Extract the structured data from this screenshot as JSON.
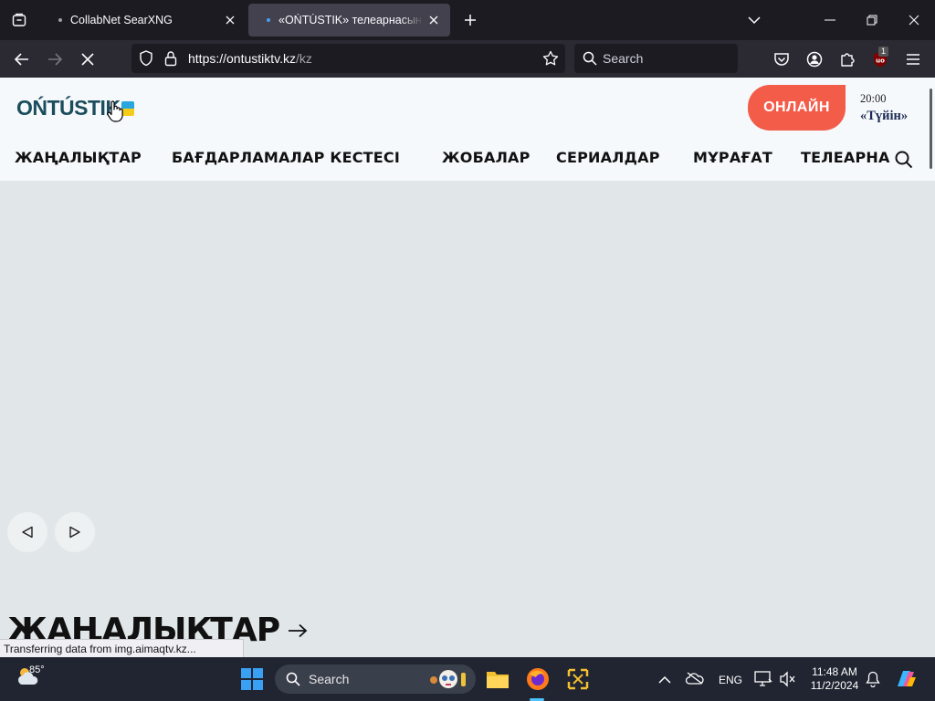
{
  "browser": {
    "tabs": [
      {
        "title": "CollabNet SearXNG",
        "active": false
      },
      {
        "title": "«OŃTÚSTIK» телеарнасының ресми",
        "active": true
      }
    ],
    "url": {
      "host": "https://ontustiktv.kz",
      "path": "/kz"
    },
    "search_placeholder": "Search",
    "extension_badge": "1",
    "status_text": "Transferring data from img.aimaqtv.kz..."
  },
  "site": {
    "logo_text": "OŃTÚSTIK",
    "online_label": "ОНЛАЙН",
    "schedule": {
      "time": "20:00",
      "show": "«Түйін»"
    },
    "menu": [
      {
        "label": "ЖАҢАЛЫҚТАР"
      },
      {
        "label": "БАҒДАРЛАМАЛАР КЕСТЕСІ"
      },
      {
        "label": "ЖОБАЛАР"
      },
      {
        "label": "СЕРИАЛДАР"
      },
      {
        "label": "МҰРАҒАТ"
      },
      {
        "label": "ТЕЛЕАРНА"
      }
    ],
    "news_heading": "ЖАҢАЛЫҚТАР"
  },
  "taskbar": {
    "weather_temp": "85°",
    "search_placeholder": "Search",
    "language": "ENG",
    "time": "11:48 AM",
    "date": "11/2/2024"
  },
  "colors": {
    "accent_online": "#f45c4a",
    "logo": "#1c4d5d",
    "page_bg": "#e1e6e8"
  }
}
